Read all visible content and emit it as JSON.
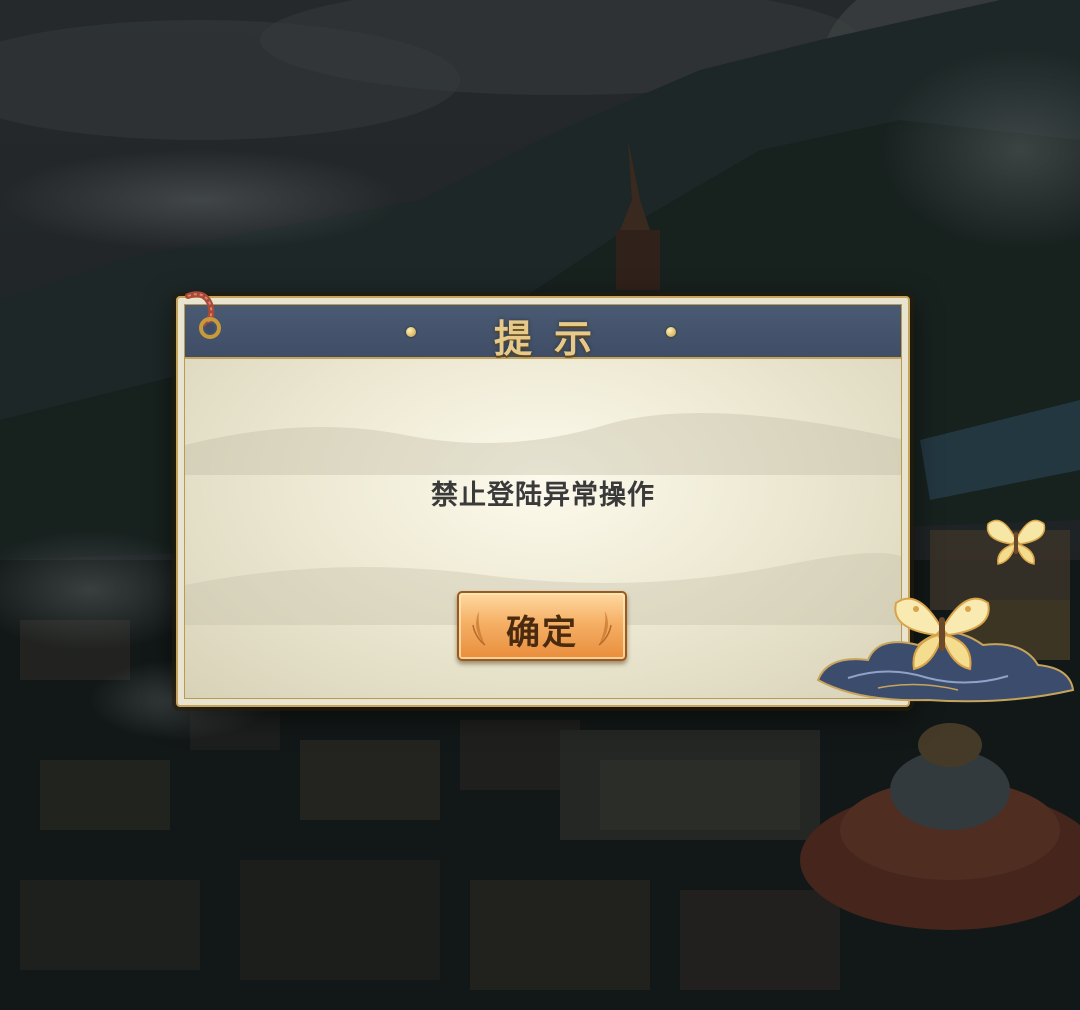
{
  "dialog": {
    "title": "提示",
    "message": "禁止登陆异常操作",
    "confirm_label": "确定"
  },
  "colors": {
    "header": "#44546c",
    "gold_border": "#c6a45c",
    "button_orange": "#f0a050",
    "title_gold": "#e7c98a"
  },
  "icons": [
    "rope-icon",
    "butterfly-icon",
    "cloud-icon",
    "leaf-icon"
  ]
}
